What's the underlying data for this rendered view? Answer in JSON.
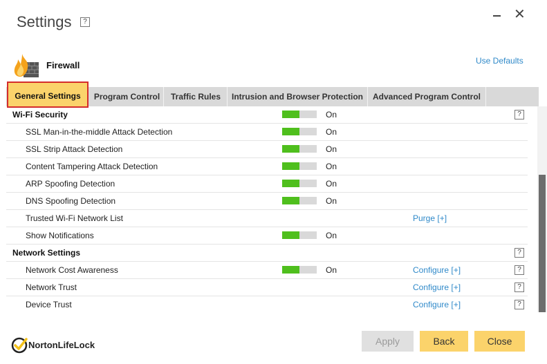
{
  "window": {
    "title": "Settings",
    "help_glyph": "?",
    "close_glyph": "✕"
  },
  "section": {
    "name": "Firewall",
    "icon": "firewall-flame-icon",
    "use_defaults_label": "Use Defaults"
  },
  "tabs": [
    {
      "label": "General Settings",
      "active": true
    },
    {
      "label": "Program Control",
      "active": false
    },
    {
      "label": "Traffic Rules",
      "active": false
    },
    {
      "label": "Intrusion and Browser Protection",
      "active": false
    },
    {
      "label": "Advanced Program Control",
      "active": false
    }
  ],
  "rows": [
    {
      "type": "header",
      "label": "Wi-Fi Security",
      "toggle_on": true,
      "state": "On",
      "help": "?"
    },
    {
      "type": "item",
      "label": "SSL Man-in-the-middle Attack Detection",
      "toggle_on": true,
      "state": "On"
    },
    {
      "type": "item",
      "label": "SSL Strip Attack Detection",
      "toggle_on": true,
      "state": "On"
    },
    {
      "type": "item",
      "label": "Content Tampering Attack Detection",
      "toggle_on": true,
      "state": "On"
    },
    {
      "type": "item",
      "label": "ARP Spoofing Detection",
      "toggle_on": true,
      "state": "On"
    },
    {
      "type": "item",
      "label": "DNS Spoofing Detection",
      "toggle_on": true,
      "state": "On"
    },
    {
      "type": "item",
      "label": "Trusted Wi-Fi Network List",
      "link": "Purge [+]"
    },
    {
      "type": "item",
      "label": "Show Notifications",
      "toggle_on": true,
      "state": "On"
    },
    {
      "type": "header",
      "label": "Network Settings",
      "help": "?"
    },
    {
      "type": "item",
      "label": "Network Cost Awareness",
      "toggle_on": true,
      "state": "On",
      "link": "Configure [+]",
      "help": "?"
    },
    {
      "type": "item",
      "label": "Network Trust",
      "link": "Configure [+]",
      "help": "?"
    },
    {
      "type": "item",
      "label": "Device Trust",
      "link": "Configure [+]",
      "help": "?"
    }
  ],
  "toggle_fill_fraction": 0.5,
  "colors": {
    "accent_yellow": "#fbd36b",
    "toggle_green": "#4fbf1d",
    "link_blue": "#2f89c9",
    "highlight_red": "#d42c2c"
  },
  "footer": {
    "brand": "NortonLifeLock",
    "brand_icon": "norton-checkmark-icon",
    "apply_label": "Apply",
    "back_label": "Back",
    "close_label": "Close"
  }
}
